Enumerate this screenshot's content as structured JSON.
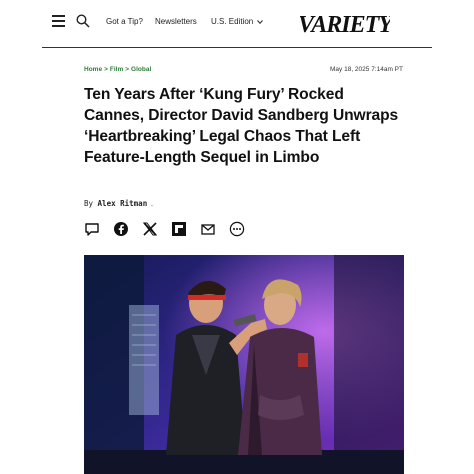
{
  "header": {
    "nav_tip": "Got a Tip?",
    "nav_newsletters": "Newsletters",
    "nav_edition": "U.S. Edition",
    "logo_text": "VARIETY"
  },
  "article": {
    "breadcrumb": [
      "Home",
      ">",
      "Film",
      ">",
      "Global"
    ],
    "date": "May 18, 2025 7:14am PT",
    "headline": "Ten Years After ‘Kung Fury’ Rocked Cannes, Director David Sandberg Unwraps ‘Heartbreaking’ Legal Chaos That Left Feature-Length Sequel in Limbo",
    "byline_prefix": "By",
    "author": "Alex Ritman"
  },
  "share_icons": [
    "comment-icon",
    "facebook-icon",
    "x-icon",
    "flipboard-icon",
    "email-icon",
    "more-icon"
  ]
}
